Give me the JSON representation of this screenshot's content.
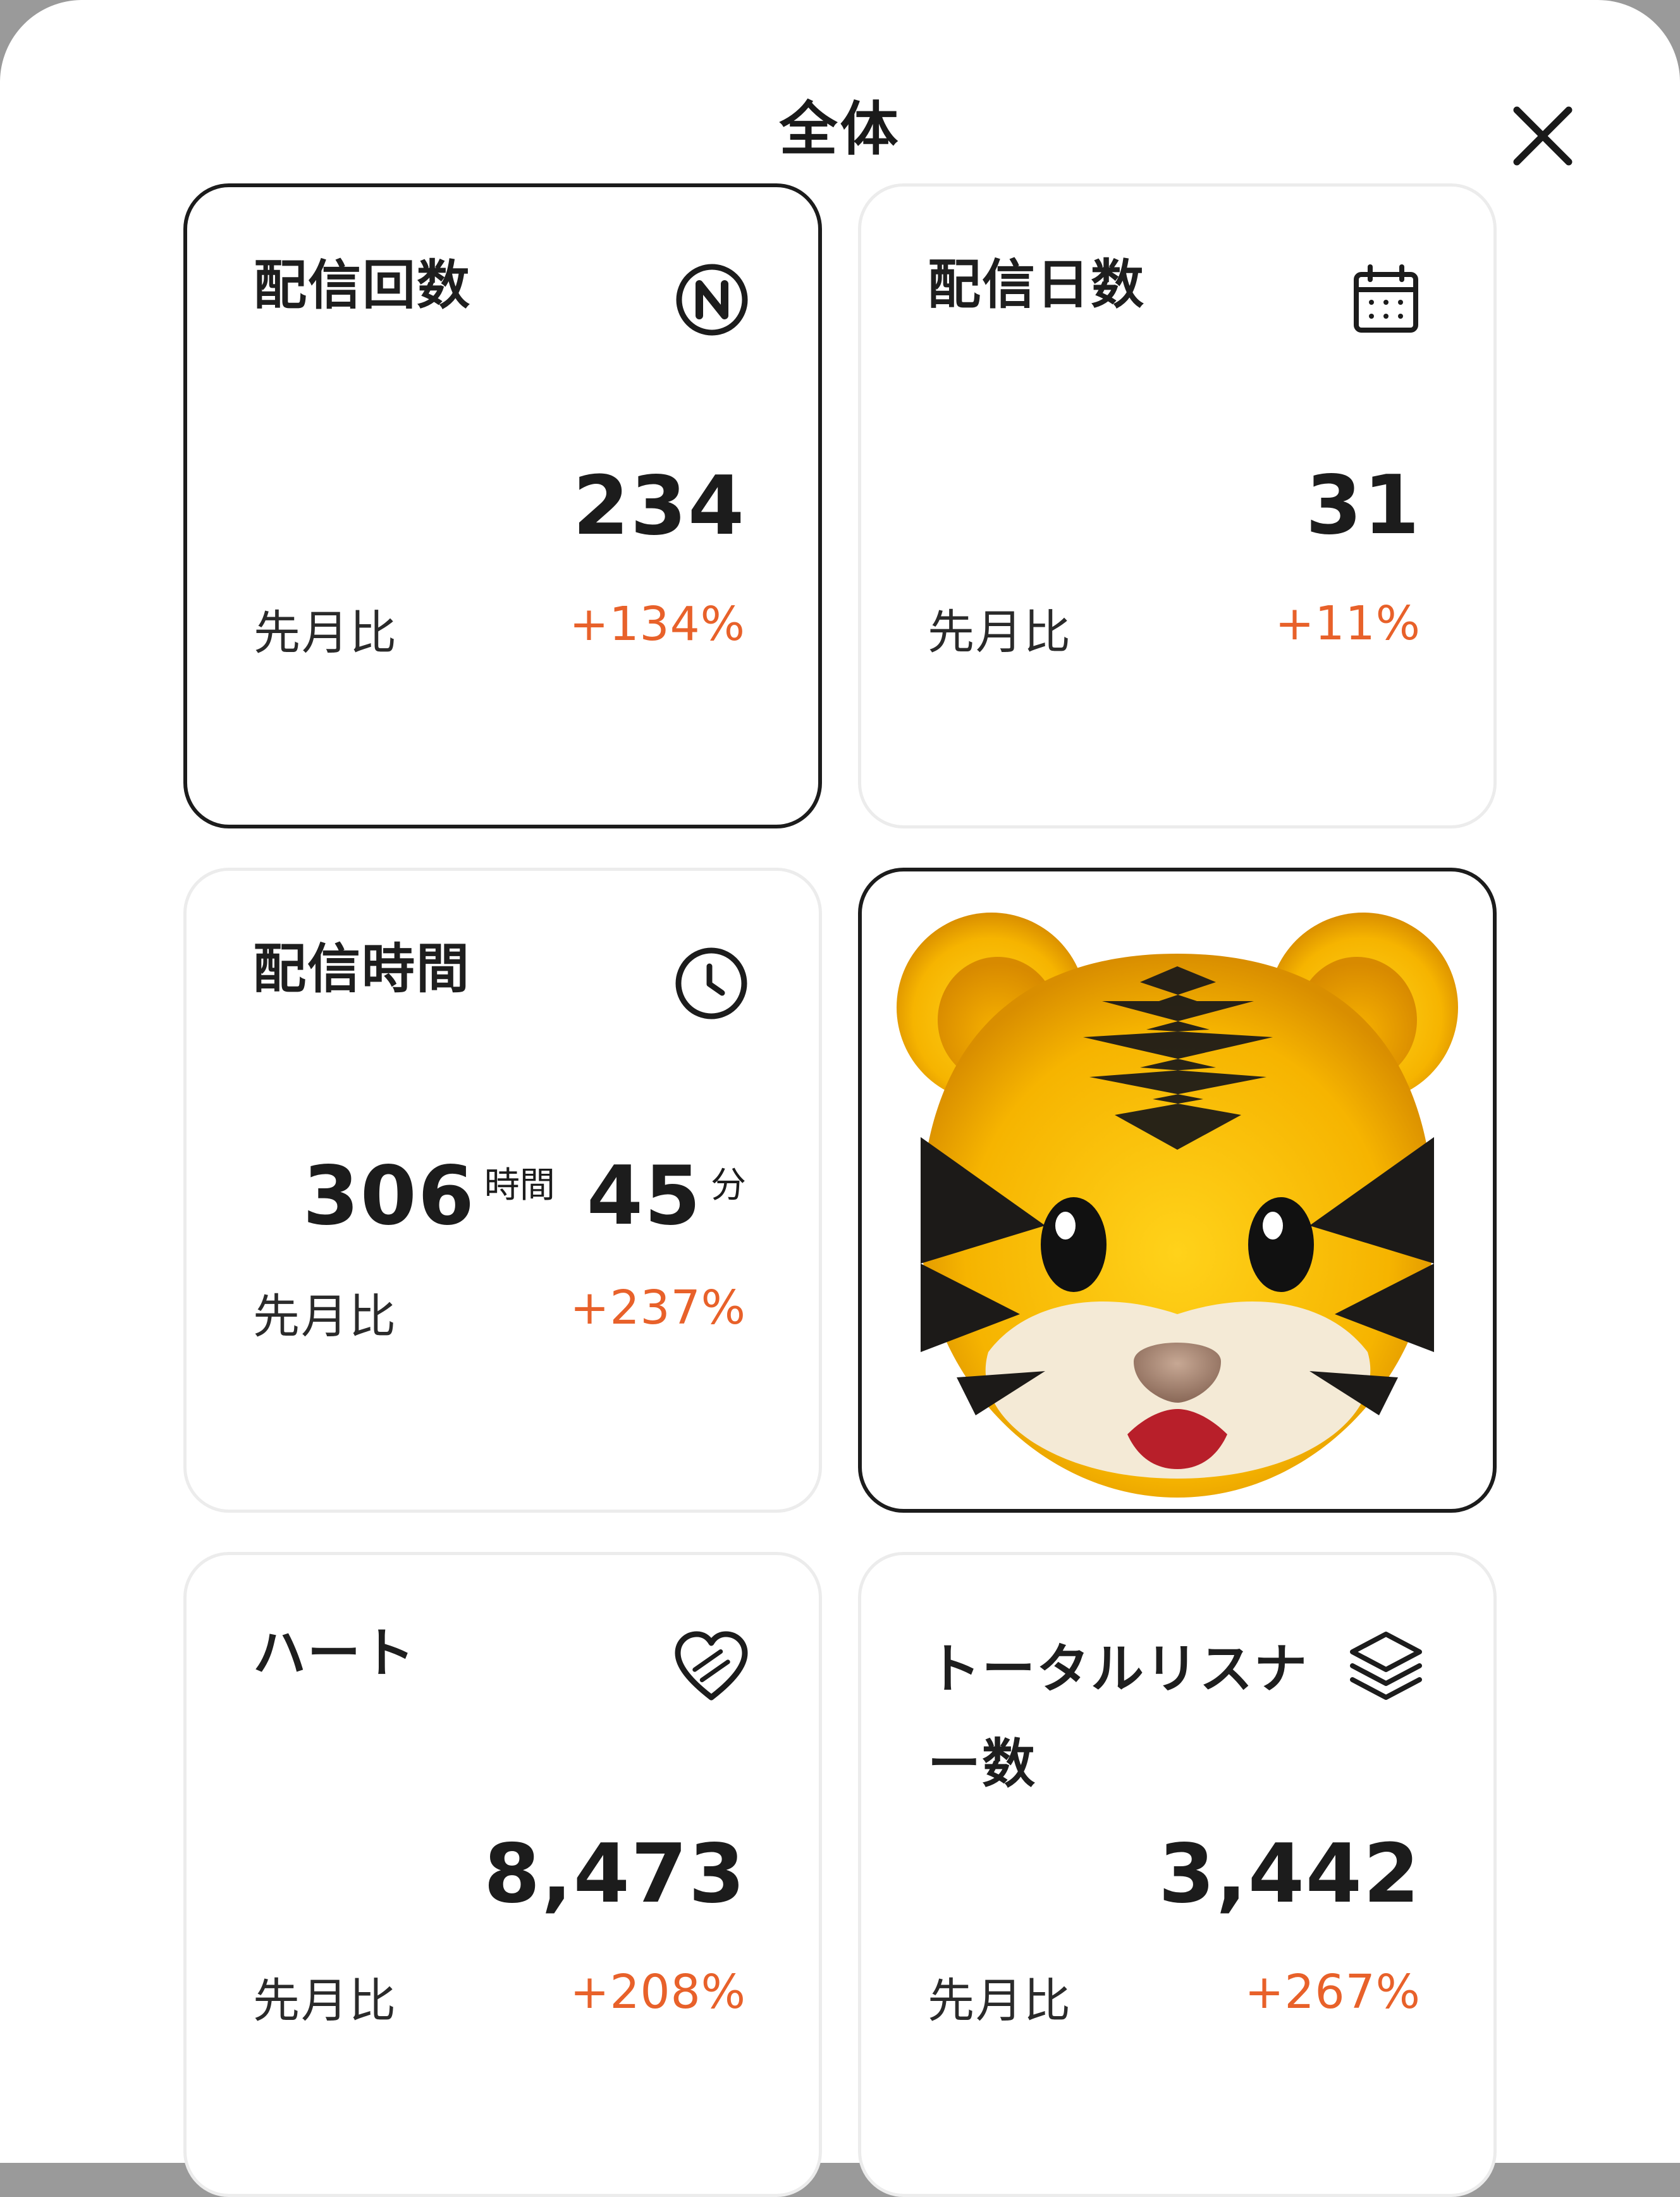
{
  "header": {
    "title": "全体"
  },
  "cards": [
    {
      "title": "配信回数",
      "icon": "n-circle-icon",
      "value": "234",
      "compare_label": "先月比",
      "compare_value": "+134%"
    },
    {
      "title": "配信日数",
      "icon": "calendar-icon",
      "value": "31",
      "compare_label": "先月比",
      "compare_value": "+11%"
    },
    {
      "title": "配信時間",
      "icon": "clock-icon",
      "hours": "306",
      "hours_unit": "時間",
      "minutes": "45",
      "minutes_unit": "分",
      "compare_label": "先月比",
      "compare_value": "+237%"
    },
    {
      "title": "ハート",
      "icon": "heart-icon",
      "value": "8,473",
      "compare_label": "先月比",
      "compare_value": "+208%"
    },
    {
      "title": "トータルリスナー数",
      "icon": "layers-icon",
      "value": "3,442",
      "compare_label": "先月比",
      "compare_value": "+267%"
    }
  ],
  "colors": {
    "accent": "#e8612a",
    "text": "#1c1c1c",
    "card_border": "#ececec",
    "selected_border": "#1c1c1c"
  }
}
